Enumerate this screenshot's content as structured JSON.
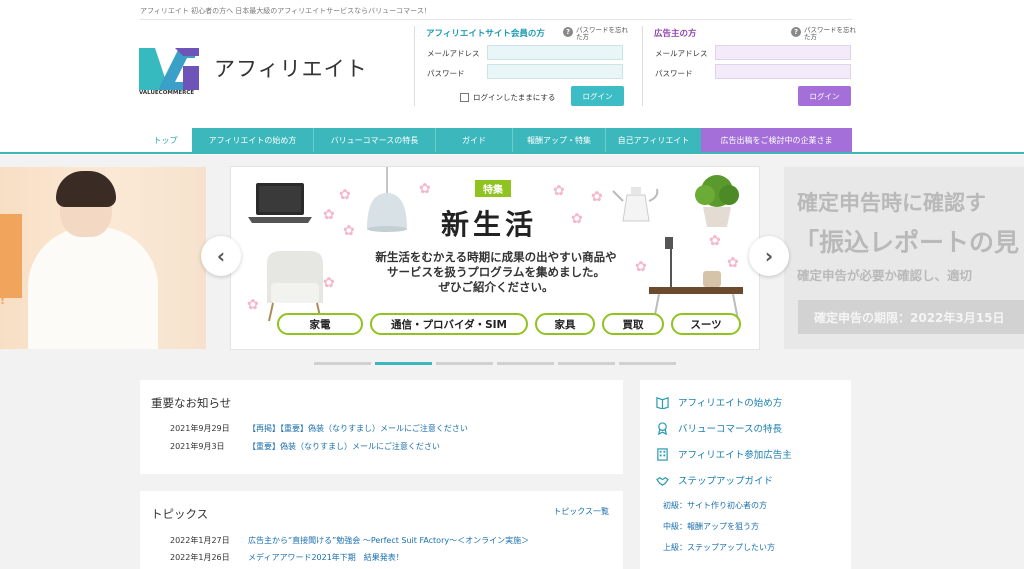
{
  "header": {
    "tagline": "アフィリエイト 初心者の方へ 日本最大級のアフィリエイトサービスならバリューコマース！",
    "logo_sub": "VALUECOMMERCE",
    "brand": "アフィリエイト"
  },
  "member_login": {
    "title": "アフィリエイトサイト会員の方",
    "forgot": "パスワードを忘れた方",
    "email_label": "メールアドレス",
    "password_label": "パスワード",
    "stay_logged_in": "ログインしたままにする",
    "login_button": "ログイン",
    "email_value": "",
    "password_value": ""
  },
  "advertiser_login": {
    "title": "広告主の方",
    "forgot": "パスワードを忘れた方",
    "email_label": "メールアドレス",
    "password_label": "パスワード",
    "login_button": "ログイン",
    "email_value": "",
    "password_value": ""
  },
  "nav": {
    "items": [
      "トップ",
      "アフィリエイトの始め方",
      "バリューコマースの特長",
      "ガイド",
      "報酬アップ・特集",
      "自己アフィリエイト"
    ],
    "active_index": 0,
    "ad_item": "広告出稿をご検討中の企業さま"
  },
  "carousel": {
    "left_partial_text": "!",
    "main": {
      "badge": "特集",
      "title": "新生活",
      "desc_line1": "新生活をむかえる時期に成果の出やすい商品や",
      "desc_line2": "サービスを扱うプログラムを集めました。",
      "desc_line3": "ぜひご紹介ください。",
      "pills": [
        "家電",
        "通信・プロバイダ・SIM",
        "家具",
        "買取",
        "スーツ"
      ]
    },
    "right_partial": {
      "line1": "確定申告時に確認す",
      "line2": "「振込レポートの見",
      "line3": "確定申告が必要か確認し、適切",
      "band": "確定申告の期限：2022年3月15日"
    },
    "prev_icon": "chevron-left-icon",
    "next_icon": "chevron-right-icon",
    "indicator_count": 6,
    "active_indicator": 1
  },
  "news": {
    "title": "重要なお知らせ",
    "items": [
      {
        "date": "2021年9月29日",
        "text": "【再掲】【重要】偽装（なりすまし）メールにご注意ください"
      },
      {
        "date": "2021年9月3日",
        "text": "【重要】偽装（なりすまし）メールにご注意ください"
      }
    ]
  },
  "topics": {
    "title": "トピックス",
    "more": "トピックス一覧",
    "items": [
      {
        "date": "2022年1月27日",
        "text": "広告主から“直接聞ける”勉強会 〜Perfect Suit FActory〜＜オンライン実施＞"
      },
      {
        "date": "2022年1月26日",
        "text": "メディアアワード2021年下期　結果発表！"
      }
    ]
  },
  "sidebar": {
    "items": [
      {
        "label": "アフィリエイトの始め方",
        "icon": "book-icon"
      },
      {
        "label": "バリューコマースの特長",
        "icon": "award-icon"
      },
      {
        "label": "アフィリエイト参加広告主",
        "icon": "building-icon"
      },
      {
        "label": "ステップアップガイド",
        "icon": "handshake-icon"
      }
    ],
    "sub_items": [
      "初級：サイト作り初心者の方",
      "中級：報酬アップを狙う方",
      "上級：ステップアップしたい方"
    ]
  },
  "colors": {
    "teal": "#3cb8bd",
    "purple": "#a46fd9",
    "link": "#1a6fae",
    "green": "#8fc31f"
  }
}
